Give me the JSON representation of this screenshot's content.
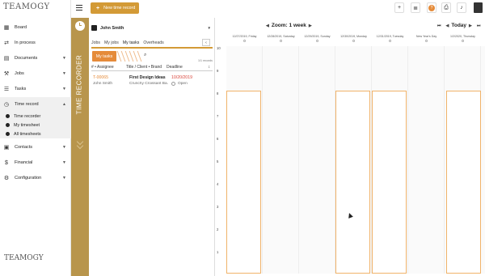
{
  "app": {
    "logo_text": "TEAMOGY"
  },
  "topbar": {
    "new_record_label": "New time record",
    "icons": [
      "plus-icon",
      "note-icon",
      "help-icon",
      "print-icon",
      "bell-icon",
      "user-avatar"
    ]
  },
  "sidebar": {
    "items": [
      {
        "label": "Board",
        "icon": "grid-icon",
        "has_children": false
      },
      {
        "label": "In process",
        "icon": "flow-icon",
        "has_children": false
      },
      {
        "label": "Documents",
        "icon": "document-icon",
        "has_children": true
      },
      {
        "label": "Jobs",
        "icon": "jobs-icon",
        "has_children": true
      },
      {
        "label": "Tasks",
        "icon": "tasks-icon",
        "has_children": true
      },
      {
        "label": "Time record",
        "icon": "clock-icon",
        "has_children": true,
        "expanded": true
      },
      {
        "label": "Contacts",
        "icon": "contacts-icon",
        "has_children": true
      },
      {
        "label": "Financial",
        "icon": "dollar-icon",
        "has_children": true
      },
      {
        "label": "Configuration",
        "icon": "gear-icon",
        "has_children": true
      }
    ],
    "time_record_children": [
      "Time recorder",
      "My timesheet",
      "All timesheets"
    ]
  },
  "recorder": {
    "strip_title": "TIME RECORDER"
  },
  "panel": {
    "user_name": "John Smith",
    "tabs": [
      "Jobs",
      "My jobs",
      "My tasks",
      "Overheads"
    ],
    "active_tab": "My tasks",
    "filter_pill": "My tasks",
    "count_text": "1/1 records",
    "columns": {
      "assignee": "# • Assignee",
      "title": "Title / Client • Brand",
      "deadline": "Deadline",
      "sort": "↕"
    },
    "tasks": [
      {
        "id": "T-00065",
        "assignee": "John Smith",
        "title": "First Design Ideas",
        "client": "Crunchy Croissant Ba...",
        "deadline": "10/20/2019",
        "status": "Open"
      }
    ]
  },
  "calendar": {
    "zoom_label": "Zoom: 1 week",
    "today_label": "Today",
    "days": [
      {
        "date": "12/27/2019, Friday",
        "count": "0"
      },
      {
        "date": "12/28/2019, Saturday",
        "count": "0"
      },
      {
        "date": "12/29/2019, Sunday",
        "count": "0"
      },
      {
        "date": "12/30/2019, Monday",
        "count": "0"
      },
      {
        "date": "12/31/2019, Tuesday",
        "count": "0"
      },
      {
        "date": "New Year's Day",
        "count": "0"
      },
      {
        "date": "1/2/2020, Thursday",
        "count": "0"
      }
    ],
    "hours": [
      "10",
      "9",
      "8",
      "7",
      "6",
      "5",
      "4",
      "3",
      "2",
      "1"
    ],
    "work_days": [
      0,
      3,
      4,
      6
    ]
  },
  "colors": {
    "accent": "#d39a36",
    "orange": "#e58b3a",
    "strip": "#b8954c",
    "deadline": "#d9443a"
  }
}
